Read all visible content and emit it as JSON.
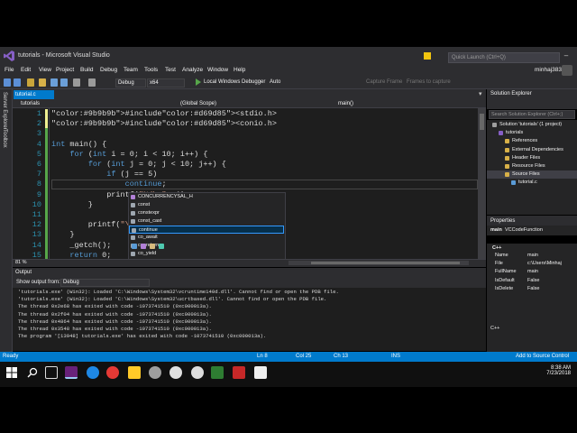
{
  "window": {
    "title": "tutorials - Microsoft Visual Studio",
    "quick_launch_placeholder": "Quick Launch (Ctrl+Q)",
    "user": "minhaj3838"
  },
  "menu": [
    "File",
    "Edit",
    "View",
    "Project",
    "Build",
    "Debug",
    "Team",
    "Tools",
    "Test",
    "Analyze",
    "Window",
    "Help"
  ],
  "toolbar": {
    "config": "Debug",
    "platform": "x64",
    "run_label": "Local Windows Debugger",
    "run_mode": "Auto",
    "capture_frame": "Capture Frame",
    "frames_to_capture": "Frames to capture"
  },
  "left_tabs": [
    "Server Explorer",
    "Toolbox"
  ],
  "editor": {
    "tab_name": "tutorial.c",
    "nav_project": "tutorials",
    "nav_scope": "(Global Scope)",
    "nav_function": "main()",
    "lines": [
      {
        "num": "1",
        "text": "#include<stdio.h>"
      },
      {
        "num": "2",
        "text": "#include<conio.h>"
      },
      {
        "num": "3",
        "text": ""
      },
      {
        "num": "4",
        "text": "int main() {"
      },
      {
        "num": "5",
        "text": "    for (int i = 0; i < 10; i++) {"
      },
      {
        "num": "6",
        "text": "        for (int j = 0; j < 10; j++) {"
      },
      {
        "num": "7",
        "text": "            if (j == 5)"
      },
      {
        "num": "8",
        "text": "                continue;"
      },
      {
        "num": "9",
        "text": "            printf(\"%d\\n\", j);"
      },
      {
        "num": "10",
        "text": "        }"
      },
      {
        "num": "11",
        "text": ""
      },
      {
        "num": "12",
        "text": "        printf(\"\\n\");"
      },
      {
        "num": "13",
        "text": "    }"
      },
      {
        "num": "14",
        "text": "    _getch();"
      },
      {
        "num": "15",
        "text": "    return 0;"
      }
    ],
    "zoom": "81 %"
  },
  "intellisense": {
    "items": [
      "CONCURRENCYSAL_H",
      "const",
      "constexpr",
      "const_cast",
      "continue",
      "co_await",
      "co_return",
      "co_yield",
      "cprintf"
    ],
    "selected_index": 4
  },
  "output": {
    "title": "Output",
    "show_from_label": "Show output from:",
    "show_from_value": "Debug",
    "lines": [
      "'tutorials.exe' (Win32): Loaded 'C:\\Windows\\System32\\vcruntime140d.dll'. Cannot find or open the PDB file.",
      "'tutorials.exe' (Win32): Loaded 'C:\\Windows\\System32\\ucrtbased.dll'. Cannot find or open the PDB file.",
      "The thread 0x2e68 has exited with code -1073741510 (0xc000013a).",
      "The thread 0x2f04 has exited with code -1073741510 (0xc000013a).",
      "The thread 0x4864 has exited with code -1073741510 (0xc000013a).",
      "The thread 0x3548 has exited with code -1073741510 (0xc000013a).",
      "The program '[13948] tutorials.exe' has exited with code -1073741510 (0xc000013a)."
    ]
  },
  "solution_explorer": {
    "title": "Solution Explorer",
    "search_placeholder": "Search Solution Explorer (Ctrl+;)",
    "items": [
      {
        "label": "Solution 'tutorials' (1 project)",
        "indent": 0
      },
      {
        "label": "tutorials",
        "indent": 1
      },
      {
        "label": "References",
        "indent": 2
      },
      {
        "label": "External Dependencies",
        "indent": 2
      },
      {
        "label": "Header Files",
        "indent": 2
      },
      {
        "label": "Resource Files",
        "indent": 2
      },
      {
        "label": "Source Files",
        "indent": 2
      },
      {
        "label": "tutorial.c",
        "indent": 3
      }
    ],
    "selected_index": 6
  },
  "properties": {
    "title": "Properties",
    "object_name": "main",
    "object_type": "VCCodeFunction",
    "section": "C++",
    "rows": [
      {
        "key": "Name",
        "value": "main"
      },
      {
        "key": "File",
        "value": "c:\\Users\\Minhaj"
      },
      {
        "key": "FullName",
        "value": "main"
      },
      {
        "key": "IsDefault",
        "value": "False"
      },
      {
        "key": "IsDelete",
        "value": "False"
      }
    ],
    "footer": "C++"
  },
  "status": {
    "left": "Ready",
    "line": "Ln 8",
    "col": "Col 25",
    "ch": "Ch 13",
    "mode": "INS",
    "source_control": "Add to Source Control"
  },
  "taskbar": {
    "time": "8:38 AM",
    "date": "7/23/2018"
  },
  "colors": {
    "accent": "#007acc",
    "editor_bg": "#1e1e1e",
    "keyword": "#569cd6",
    "string": "#d69d85"
  }
}
